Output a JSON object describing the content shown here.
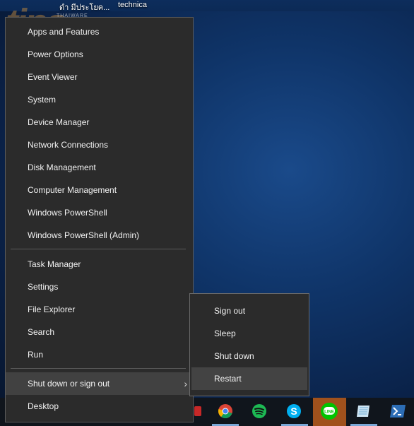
{
  "desktop": {
    "top_labels": [
      "ดำ มีประโยค...",
      "technica"
    ],
    "watermark": "tips",
    "watermark_sub": "THAIWARE"
  },
  "menu": {
    "group1": [
      "Apps and Features",
      "Power Options",
      "Event Viewer",
      "System",
      "Device Manager",
      "Network Connections",
      "Disk Management",
      "Computer Management",
      "Windows PowerShell",
      "Windows PowerShell (Admin)"
    ],
    "group2": [
      "Task Manager",
      "Settings",
      "File Explorer",
      "Search",
      "Run"
    ],
    "group3": [
      "Shut down or sign out",
      "Desktop"
    ],
    "chevron": "›"
  },
  "submenu": {
    "items": [
      "Sign out",
      "Sleep",
      "Shut down",
      "Restart"
    ],
    "highlighted": "Restart"
  },
  "taskbar": {
    "icons": [
      "chrome-icon",
      "spotify-icon",
      "skype-icon",
      "line-icon",
      "notes-app-icon",
      "powershell-icon"
    ],
    "line_label": "LINE",
    "active_color": "#a0511c"
  }
}
